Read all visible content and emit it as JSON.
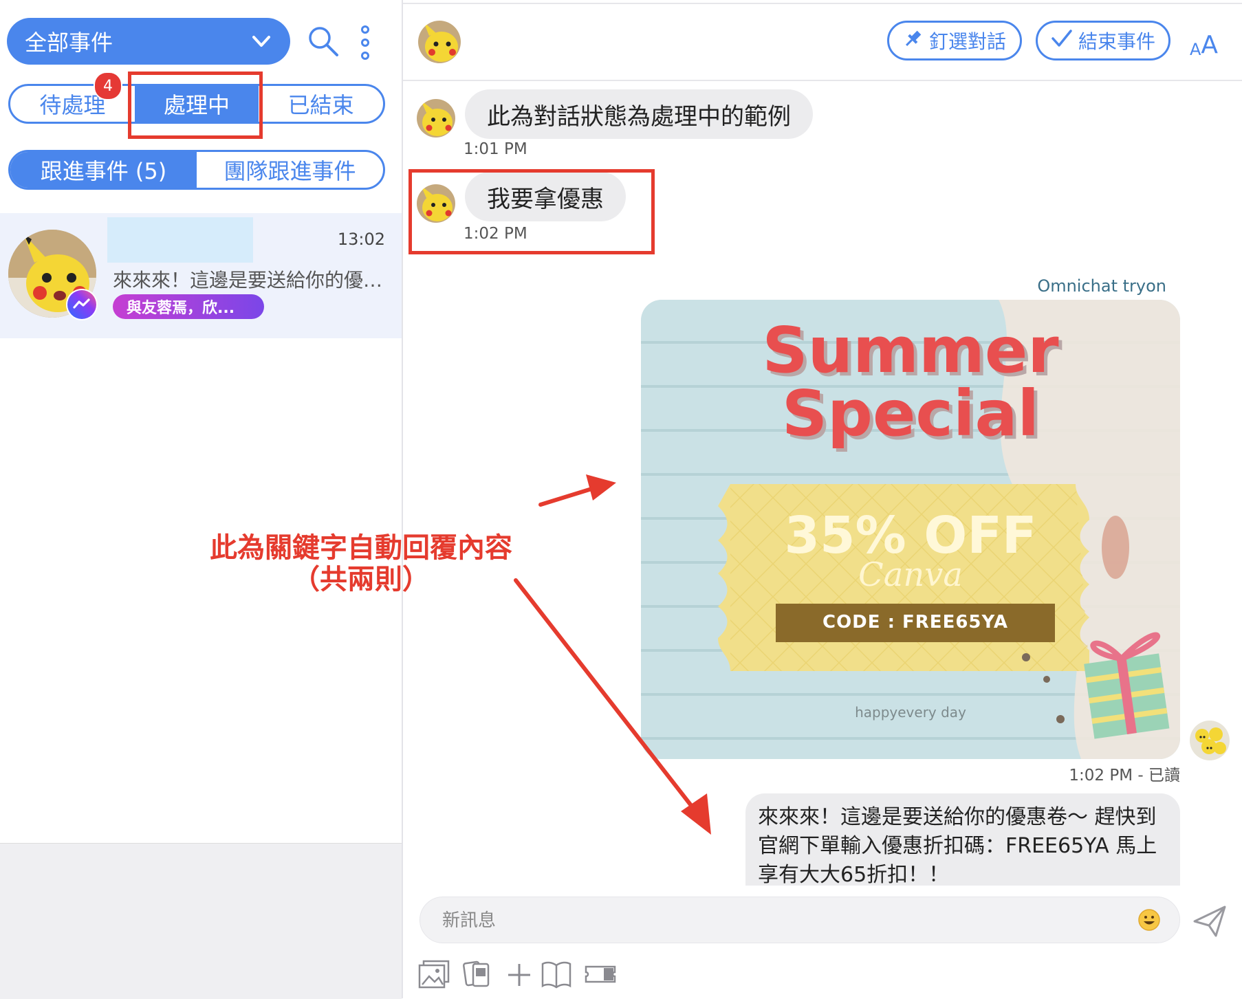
{
  "sidebar": {
    "filter_label": "全部事件",
    "status_tabs": [
      {
        "label": "待處理",
        "badge": "4",
        "active": false
      },
      {
        "label": "處理中",
        "active": true
      },
      {
        "label": "已結束",
        "active": false
      }
    ],
    "follow_tabs": [
      {
        "label": "跟進事件 (5)",
        "active": true
      },
      {
        "label": "團隊跟進事件",
        "active": false
      }
    ],
    "conversations": [
      {
        "time": "13:02",
        "preview": "來來來！這邊是要送給你的優惠卷～",
        "tag": "與友蓉焉，欣...",
        "channel_icon": "messenger-icon"
      }
    ]
  },
  "header": {
    "pin_label": "釘選對話",
    "close_label": "結束事件",
    "font_size_label": "AA"
  },
  "messages": [
    {
      "text": "此為對話狀態為處理中的範例",
      "time": "1:01 PM",
      "direction": "incoming"
    },
    {
      "text": "我要拿優惠",
      "time": "1:02 PM",
      "direction": "incoming"
    }
  ],
  "reply": {
    "sender": "Omnichat tryon",
    "image": {
      "line1": "Summer",
      "line2": "Special",
      "discount": "35% OFF",
      "brand": "Canva",
      "code": "CODE : FREE65YA",
      "footer": "happyevery day"
    },
    "image_time": "1:02 PM - 已讀",
    "text": "來來來！這邊是要送給你的優惠卷～ 趕快到官網下單輸入優惠折扣碼：FREE65YA 馬上享有大大65折扣！！"
  },
  "composer": {
    "placeholder": "新訊息"
  },
  "annotation": {
    "line1": "此為關鍵字自動回覆內容",
    "line2": "（共兩則）"
  },
  "colors": {
    "accent": "#4a86ec",
    "highlight": "#e53b2e",
    "bubble": "#ececee"
  }
}
